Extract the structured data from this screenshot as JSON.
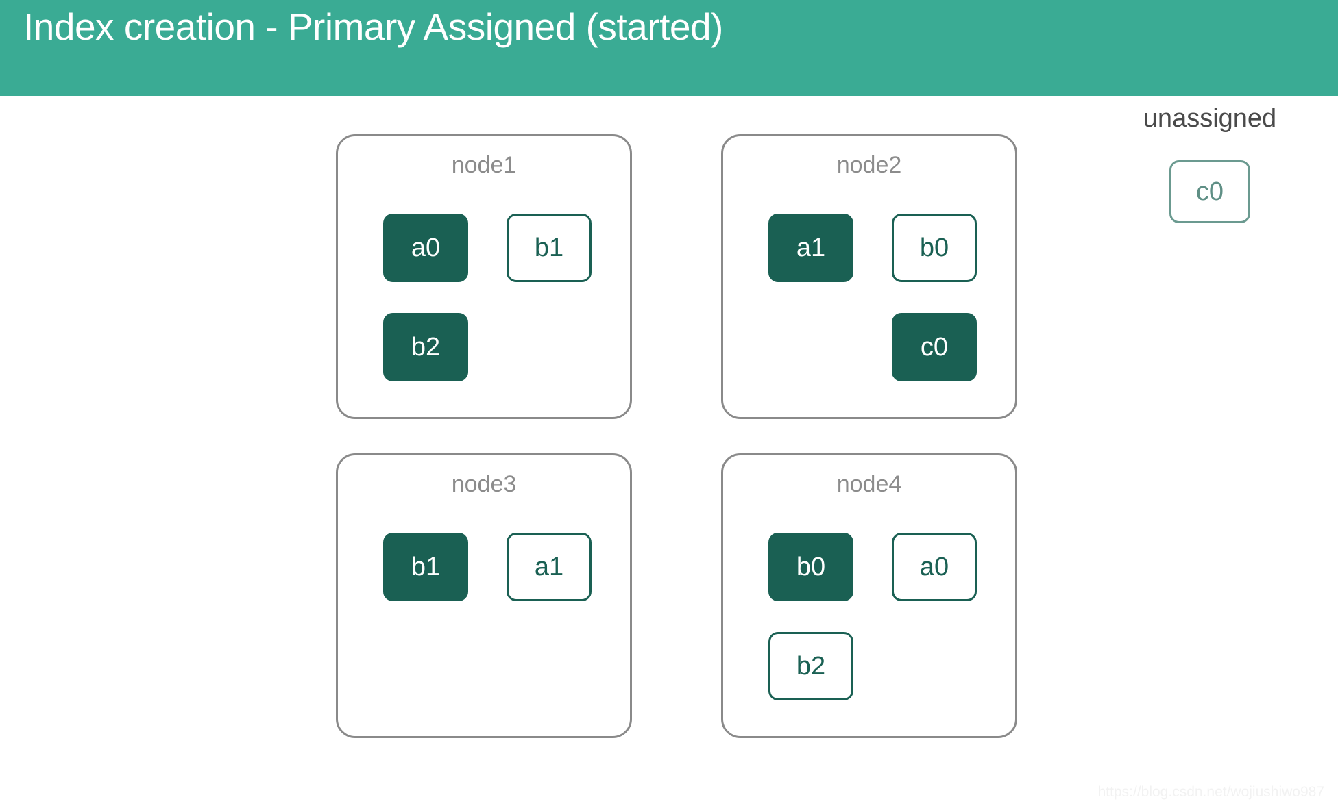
{
  "header": {
    "title": "Index creation - Primary Assigned (started)",
    "background_color": "#3aab94",
    "text_color": "#ffffff"
  },
  "colors": {
    "primary_shard_fill": "#1a6053",
    "primary_shard_text": "#ffffff",
    "replica_shard_border": "#1a6053",
    "replica_shard_text": "#1a6053",
    "unassigned_shard_border": "#6b9a90",
    "unassigned_shard_text": "#5f8f85",
    "node_border": "#8a8a8a",
    "node_label": "#8c8c8c",
    "canvas_background": "#ffffff"
  },
  "nodes": [
    {
      "label": "node1",
      "rows": [
        {
          "left": {
            "text": "a0",
            "state": "primary"
          },
          "right": {
            "text": "b1",
            "state": "replica"
          }
        },
        {
          "left": {
            "text": "b2",
            "state": "primary"
          },
          "right": {
            "text": "",
            "state": "empty"
          }
        }
      ]
    },
    {
      "label": "node2",
      "rows": [
        {
          "left": {
            "text": "a1",
            "state": "primary"
          },
          "right": {
            "text": "b0",
            "state": "replica"
          }
        },
        {
          "left": {
            "text": "",
            "state": "empty"
          },
          "right": {
            "text": "c0",
            "state": "primary"
          }
        }
      ]
    },
    {
      "label": "node3",
      "rows": [
        {
          "left": {
            "text": "b1",
            "state": "primary"
          },
          "right": {
            "text": "a1",
            "state": "replica"
          }
        },
        {
          "left": {
            "text": "",
            "state": "empty"
          },
          "right": {
            "text": "",
            "state": "empty"
          }
        }
      ]
    },
    {
      "label": "node4",
      "rows": [
        {
          "left": {
            "text": "b0",
            "state": "primary"
          },
          "right": {
            "text": "a0",
            "state": "replica"
          }
        },
        {
          "left": {
            "text": "b2",
            "state": "replica"
          },
          "right": {
            "text": "",
            "state": "empty"
          }
        }
      ]
    }
  ],
  "unassigned": {
    "label": "unassigned",
    "items": [
      {
        "text": "c0",
        "state": "unassigned"
      }
    ]
  },
  "watermark": {
    "text": "https://blog.csdn.net/wojiushiwo987"
  }
}
